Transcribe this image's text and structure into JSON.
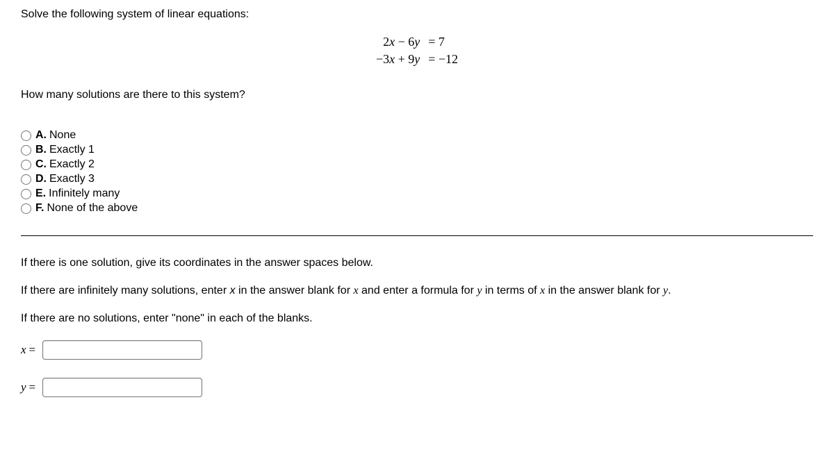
{
  "prompt": "Solve the following system of linear equations:",
  "equations": {
    "row1": {
      "lhs": "2x − 6y",
      "rhs": "= 7"
    },
    "row2": {
      "lhs": "−3x + 9y",
      "rhs": "= −12"
    }
  },
  "question": "How many solutions are there to this system?",
  "options": [
    {
      "letter": "A.",
      "text": "None"
    },
    {
      "letter": "B.",
      "text": "Exactly 1"
    },
    {
      "letter": "C.",
      "text": "Exactly 2"
    },
    {
      "letter": "D.",
      "text": "Exactly 3"
    },
    {
      "letter": "E.",
      "text": "Infinitely many"
    },
    {
      "letter": "F.",
      "text": "None of the above"
    }
  ],
  "instructions": {
    "one_solution": "If there is one solution, give its coordinates in the answer spaces below.",
    "infinite_pre": "If there are infinitely many solutions, enter ",
    "infinite_x_var": "x",
    "infinite_mid1": " in the answer blank for ",
    "infinite_math_x": "x",
    "infinite_mid2": " and enter a formula for ",
    "infinite_math_y": "y",
    "infinite_mid3": " in terms of ",
    "infinite_math_x2": "x",
    "infinite_mid4": " in the answer blank for ",
    "infinite_math_y2": "y",
    "infinite_end": ".",
    "none": "If there are no solutions, enter \"none\" in each of the blanks."
  },
  "answers": {
    "x_label": "x",
    "y_label": "y",
    "equals": "=",
    "x_value": "",
    "y_value": ""
  }
}
